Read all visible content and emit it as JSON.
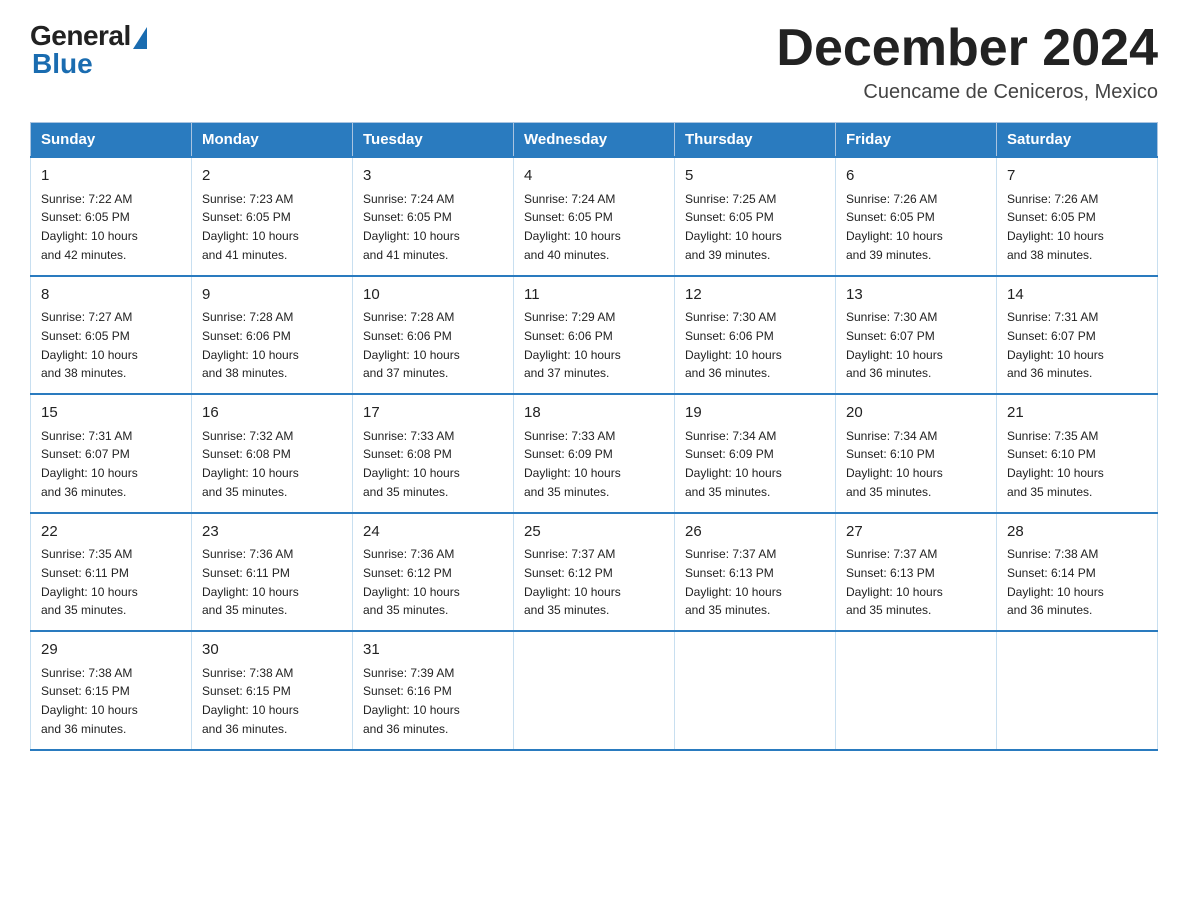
{
  "logo": {
    "general": "General",
    "blue": "Blue"
  },
  "title": "December 2024",
  "subtitle": "Cuencame de Ceniceros, Mexico",
  "weekdays": [
    "Sunday",
    "Monday",
    "Tuesday",
    "Wednesday",
    "Thursday",
    "Friday",
    "Saturday"
  ],
  "weeks": [
    [
      {
        "day": "1",
        "sunrise": "7:22 AM",
        "sunset": "6:05 PM",
        "daylight": "10 hours and 42 minutes."
      },
      {
        "day": "2",
        "sunrise": "7:23 AM",
        "sunset": "6:05 PM",
        "daylight": "10 hours and 41 minutes."
      },
      {
        "day": "3",
        "sunrise": "7:24 AM",
        "sunset": "6:05 PM",
        "daylight": "10 hours and 41 minutes."
      },
      {
        "day": "4",
        "sunrise": "7:24 AM",
        "sunset": "6:05 PM",
        "daylight": "10 hours and 40 minutes."
      },
      {
        "day": "5",
        "sunrise": "7:25 AM",
        "sunset": "6:05 PM",
        "daylight": "10 hours and 39 minutes."
      },
      {
        "day": "6",
        "sunrise": "7:26 AM",
        "sunset": "6:05 PM",
        "daylight": "10 hours and 39 minutes."
      },
      {
        "day": "7",
        "sunrise": "7:26 AM",
        "sunset": "6:05 PM",
        "daylight": "10 hours and 38 minutes."
      }
    ],
    [
      {
        "day": "8",
        "sunrise": "7:27 AM",
        "sunset": "6:05 PM",
        "daylight": "10 hours and 38 minutes."
      },
      {
        "day": "9",
        "sunrise": "7:28 AM",
        "sunset": "6:06 PM",
        "daylight": "10 hours and 38 minutes."
      },
      {
        "day": "10",
        "sunrise": "7:28 AM",
        "sunset": "6:06 PM",
        "daylight": "10 hours and 37 minutes."
      },
      {
        "day": "11",
        "sunrise": "7:29 AM",
        "sunset": "6:06 PM",
        "daylight": "10 hours and 37 minutes."
      },
      {
        "day": "12",
        "sunrise": "7:30 AM",
        "sunset": "6:06 PM",
        "daylight": "10 hours and 36 minutes."
      },
      {
        "day": "13",
        "sunrise": "7:30 AM",
        "sunset": "6:07 PM",
        "daylight": "10 hours and 36 minutes."
      },
      {
        "day": "14",
        "sunrise": "7:31 AM",
        "sunset": "6:07 PM",
        "daylight": "10 hours and 36 minutes."
      }
    ],
    [
      {
        "day": "15",
        "sunrise": "7:31 AM",
        "sunset": "6:07 PM",
        "daylight": "10 hours and 36 minutes."
      },
      {
        "day": "16",
        "sunrise": "7:32 AM",
        "sunset": "6:08 PM",
        "daylight": "10 hours and 35 minutes."
      },
      {
        "day": "17",
        "sunrise": "7:33 AM",
        "sunset": "6:08 PM",
        "daylight": "10 hours and 35 minutes."
      },
      {
        "day": "18",
        "sunrise": "7:33 AM",
        "sunset": "6:09 PM",
        "daylight": "10 hours and 35 minutes."
      },
      {
        "day": "19",
        "sunrise": "7:34 AM",
        "sunset": "6:09 PM",
        "daylight": "10 hours and 35 minutes."
      },
      {
        "day": "20",
        "sunrise": "7:34 AM",
        "sunset": "6:10 PM",
        "daylight": "10 hours and 35 minutes."
      },
      {
        "day": "21",
        "sunrise": "7:35 AM",
        "sunset": "6:10 PM",
        "daylight": "10 hours and 35 minutes."
      }
    ],
    [
      {
        "day": "22",
        "sunrise": "7:35 AM",
        "sunset": "6:11 PM",
        "daylight": "10 hours and 35 minutes."
      },
      {
        "day": "23",
        "sunrise": "7:36 AM",
        "sunset": "6:11 PM",
        "daylight": "10 hours and 35 minutes."
      },
      {
        "day": "24",
        "sunrise": "7:36 AM",
        "sunset": "6:12 PM",
        "daylight": "10 hours and 35 minutes."
      },
      {
        "day": "25",
        "sunrise": "7:37 AM",
        "sunset": "6:12 PM",
        "daylight": "10 hours and 35 minutes."
      },
      {
        "day": "26",
        "sunrise": "7:37 AM",
        "sunset": "6:13 PM",
        "daylight": "10 hours and 35 minutes."
      },
      {
        "day": "27",
        "sunrise": "7:37 AM",
        "sunset": "6:13 PM",
        "daylight": "10 hours and 35 minutes."
      },
      {
        "day": "28",
        "sunrise": "7:38 AM",
        "sunset": "6:14 PM",
        "daylight": "10 hours and 36 minutes."
      }
    ],
    [
      {
        "day": "29",
        "sunrise": "7:38 AM",
        "sunset": "6:15 PM",
        "daylight": "10 hours and 36 minutes."
      },
      {
        "day": "30",
        "sunrise": "7:38 AM",
        "sunset": "6:15 PM",
        "daylight": "10 hours and 36 minutes."
      },
      {
        "day": "31",
        "sunrise": "7:39 AM",
        "sunset": "6:16 PM",
        "daylight": "10 hours and 36 minutes."
      },
      null,
      null,
      null,
      null
    ]
  ],
  "labels": {
    "sunrise": "Sunrise:",
    "sunset": "Sunset:",
    "daylight": "Daylight:"
  }
}
